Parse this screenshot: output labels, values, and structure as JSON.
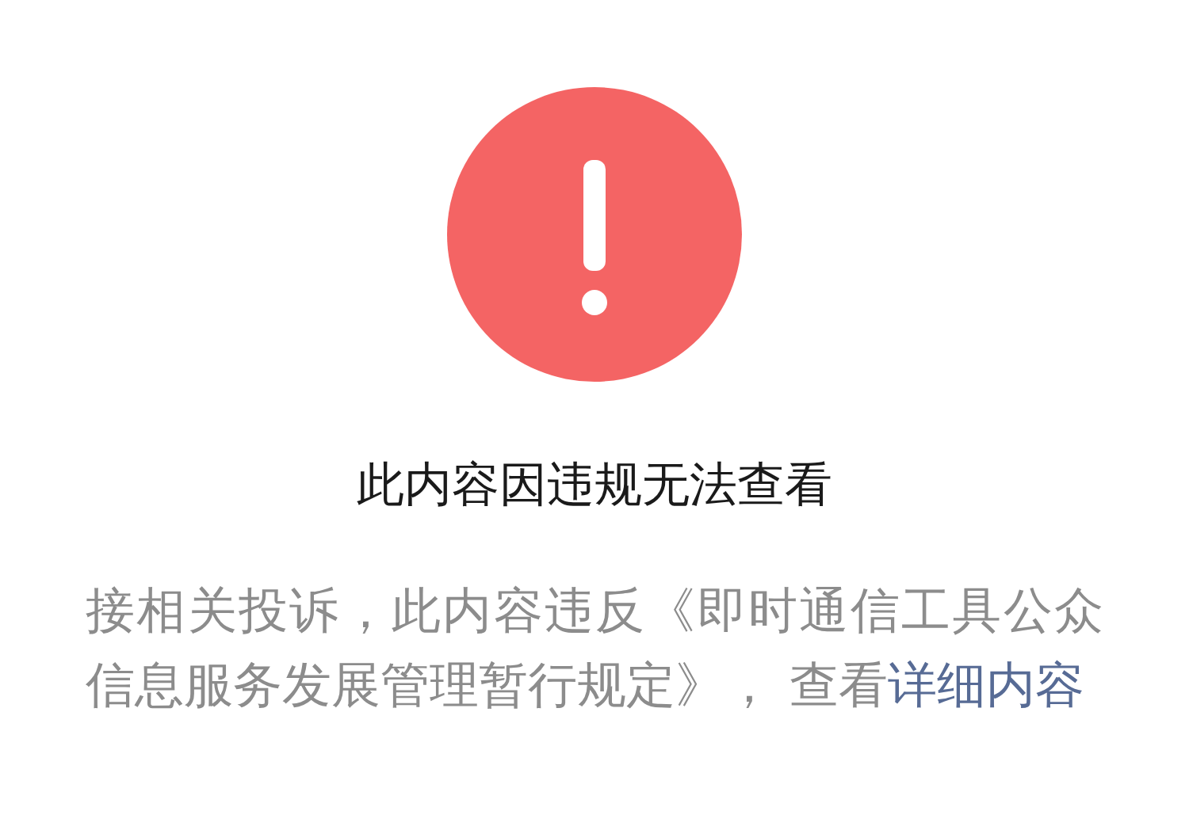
{
  "notice": {
    "title": "此内容因违规无法查看",
    "message": "接相关投诉，此内容违反《即时通信工具公众信息服务发展管理暂行规定》， 查看",
    "link": "详细内容"
  }
}
